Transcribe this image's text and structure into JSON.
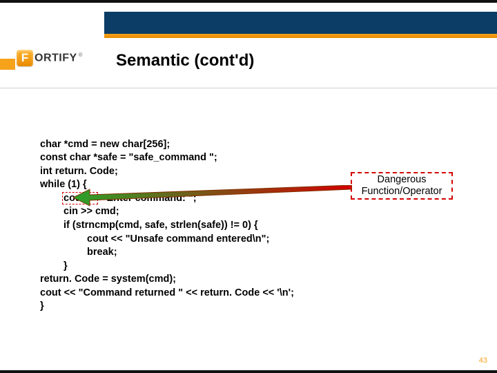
{
  "logo": {
    "initial": "F",
    "rest": "ORTIFY",
    "reg": "®"
  },
  "title": "Semantic (cont'd)",
  "code": {
    "l1": "char *cmd = new char[256];",
    "l2": "const char *safe = \"safe_command \";",
    "l3": "int return. Code;",
    "l4": "while (1) {",
    "l5": "cout << \"Enter command: \";",
    "l6": "cin >> cmd;",
    "l7": "if (strncmp(cmd, safe, strlen(safe)) != 0) {",
    "l8": "cout << \"Unsafe command entered\\n\";",
    "l9": "break;",
    "l10": "}",
    "l11": "return. Code = system(cmd);",
    "l12": "cout << \"Command returned \" << return. Code << '\\n';",
    "l13": "}"
  },
  "annotation": "Dangerous\nFunction/Operator",
  "page_number": "43",
  "colors": {
    "blue": "#0b3d66",
    "orange": "#f6a21b",
    "red": "#d40000"
  }
}
